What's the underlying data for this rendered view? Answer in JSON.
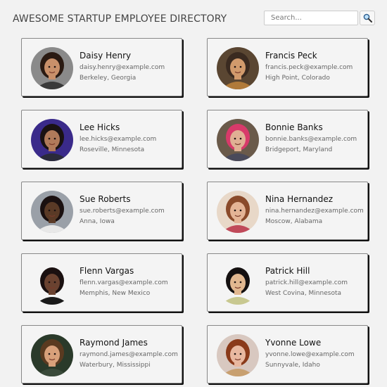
{
  "header": {
    "title": "AWESOME STARTUP EMPLOYEE DIRECTORY",
    "search_placeholder": "Search...",
    "search_icon": "magnifier-icon"
  },
  "employees": [
    {
      "name": "Daisy Henry",
      "email": "daisy.henry@example.com",
      "location": "Berkeley, Georgia",
      "skin": "#c9906a",
      "hair": "#2a1a12",
      "bg": "#8a8a8a",
      "shirt": "#3a3a3a"
    },
    {
      "name": "Francis Peck",
      "email": "francis.peck@example.com",
      "location": "High Point, Colorado",
      "skin": "#d19a6c",
      "hair": "#3a2a20",
      "bg": "#5a4632",
      "shirt": "#b07a3a"
    },
    {
      "name": "Lee Hicks",
      "email": "lee.hicks@example.com",
      "location": "Roseville, Minnesota",
      "skin": "#b07a5a",
      "hair": "#1a1212",
      "bg": "#3a2a8a",
      "shirt": "#2a2a3a"
    },
    {
      "name": "Bonnie Banks",
      "email": "bonnie.banks@example.com",
      "location": "Bridgeport, Maryland",
      "skin": "#e0b094",
      "hair": "#d83a6a",
      "bg": "#6a5a4a",
      "shirt": "#4a4a5a"
    },
    {
      "name": "Sue Roberts",
      "email": "sue.roberts@example.com",
      "location": "Anna, Iowa",
      "skin": "#5a3a26",
      "hair": "#1a1010",
      "bg": "#9aa0a8",
      "shirt": "#e8e8e8"
    },
    {
      "name": "Nina Hernandez",
      "email": "nina.hernandez@example.com",
      "location": "Moscow, Alabama",
      "skin": "#e4b496",
      "hair": "#8a4a2a",
      "bg": "#e8d8c8",
      "shirt": "#c04a5a"
    },
    {
      "name": "Flenn Vargas",
      "email": "flenn.vargas@example.com",
      "location": "Memphis, New Mexico",
      "skin": "#6a4230",
      "hair": "#1a1010",
      "bg": "#f4f4f4",
      "shirt": "#1a1a1a"
    },
    {
      "name": "Patrick Hill",
      "email": "patrick.hill@example.com",
      "location": "West Covina, Minnesota",
      "skin": "#e2b890",
      "hair": "#141010",
      "bg": "#f4f4f4",
      "shirt": "#c8c890"
    },
    {
      "name": "Raymond James",
      "email": "raymond.james@example.com",
      "location": "Waterbury, Mississippi",
      "skin": "#d8a07a",
      "hair": "#5a3a20",
      "bg": "#2a3a2a",
      "shirt": "#3a4a3a"
    },
    {
      "name": "Yvonne Lowe",
      "email": "yvonne.lowe@example.com",
      "location": "Sunnyvale, Idaho",
      "skin": "#e8b8a0",
      "hair": "#8a3a1a",
      "bg": "#d8c8c0",
      "shirt": "#c8a070"
    }
  ]
}
